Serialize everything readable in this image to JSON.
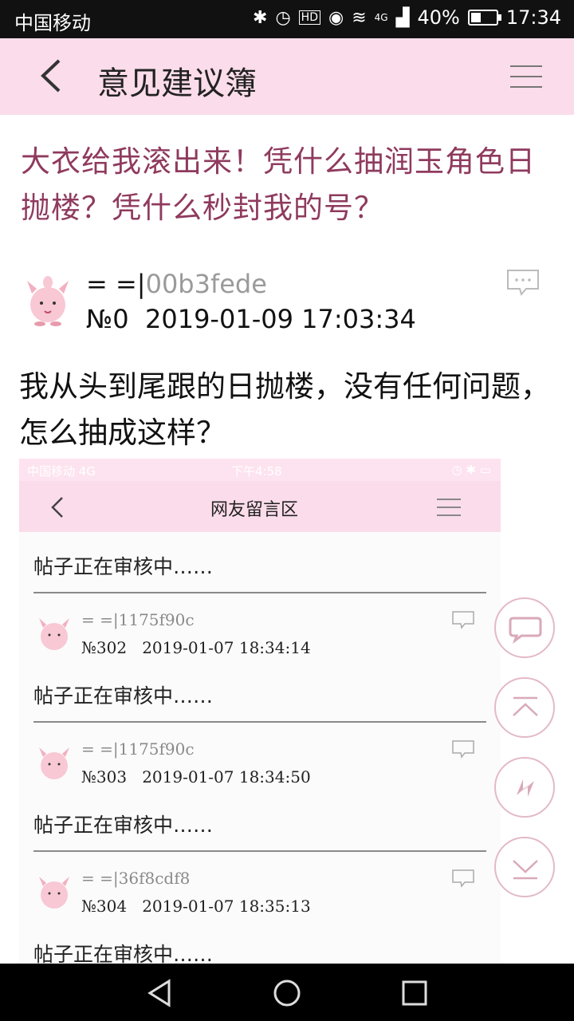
{
  "status_bar": {
    "carrier": "中国移动",
    "network": "4G",
    "battery": "40%",
    "battery_level": 0.4,
    "time": "17:34",
    "icons": [
      "bluetooth-icon",
      "alarm-icon",
      "hd-icon",
      "eye-icon",
      "wifi-icon",
      "signal-icon",
      "battery-icon"
    ]
  },
  "app_bar": {
    "title": "意见建议簿",
    "back_icon": "back-chevron-icon",
    "menu_icon": "hamburger-menu-icon"
  },
  "post": {
    "title": "大衣给我滚出来！凭什么抽润玉角色日抛楼？凭什么秒封我的号？",
    "author_prefix": "= =|",
    "author_hash": "00b3fede",
    "floor": "№0",
    "datetime": "2019-01-09 17:03:34",
    "body": "我从头到尾跟的日抛楼，没有任何问题，怎么抽成这样？"
  },
  "screenshot": {
    "status_carrier": "中国移动  4G",
    "status_time": "下午4:58",
    "title": "网友留言区",
    "top_text": "帖子正在审核中……",
    "replies": [
      {
        "author_prefix": "= =|",
        "author_hash": "1175f90c",
        "floor": "№302",
        "datetime": "2019-01-07 18:34:14",
        "text": "帖子正在审核中……"
      },
      {
        "author_prefix": "= =|",
        "author_hash": "1175f90c",
        "floor": "№303",
        "datetime": "2019-01-07 18:34:50",
        "text": "帖子正在审核中……"
      },
      {
        "author_prefix": "= =|",
        "author_hash": "36f8cdf8",
        "floor": "№304",
        "datetime": "2019-01-07 18:35:13",
        "text": "帖子正在审核中……"
      }
    ]
  },
  "fabs": [
    "comment-icon",
    "scroll-top-icon",
    "refresh-icon",
    "scroll-bottom-icon"
  ],
  "nav_bar": [
    "nav-back-icon",
    "nav-home-icon",
    "nav-recents-icon"
  ],
  "colors": {
    "accent_pink": "#fbdcea",
    "title_color": "#8f3a5e",
    "fab_border": "#e3b9c9"
  }
}
